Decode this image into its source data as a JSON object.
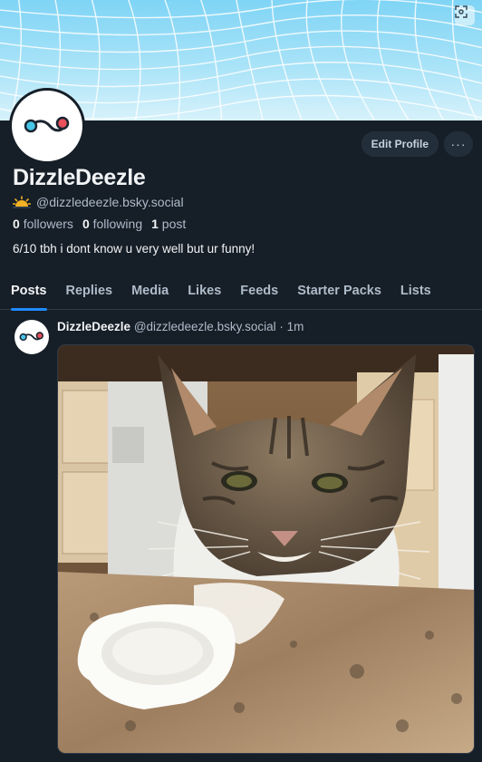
{
  "colors": {
    "background": "#161e27",
    "accent": "#208bfe",
    "muted": "#aebbc9",
    "text": "#f1f3f5"
  },
  "banner": {
    "pattern": "warped-grid",
    "expand_icon": "expand-icon"
  },
  "profile": {
    "display_name": "DizzleDeezle",
    "handle_icon": "sunrise-emoji",
    "handle": "@dizzledeezle.bsky.social",
    "followers_count": "0",
    "followers_label": "followers",
    "following_count": "0",
    "following_label": "following",
    "posts_count": "1",
    "posts_label": "post",
    "bio": "6/10 tbh i dont know u very well but ur funny!",
    "edit_label": "Edit Profile",
    "more_label": "···"
  },
  "tabs": [
    {
      "label": "Posts",
      "active": true
    },
    {
      "label": "Replies",
      "active": false
    },
    {
      "label": "Media",
      "active": false
    },
    {
      "label": "Likes",
      "active": false
    },
    {
      "label": "Feeds",
      "active": false
    },
    {
      "label": "Starter Packs",
      "active": false
    },
    {
      "label": "Lists",
      "active": false
    }
  ],
  "post": {
    "author": "DizzleDeezle",
    "handle": "@dizzledeezle.bsky.social",
    "separator": "·",
    "time": "1m",
    "image": "tabby-cat-with-milk-on-whiskers-beside-bowl-on-granite-counter"
  }
}
